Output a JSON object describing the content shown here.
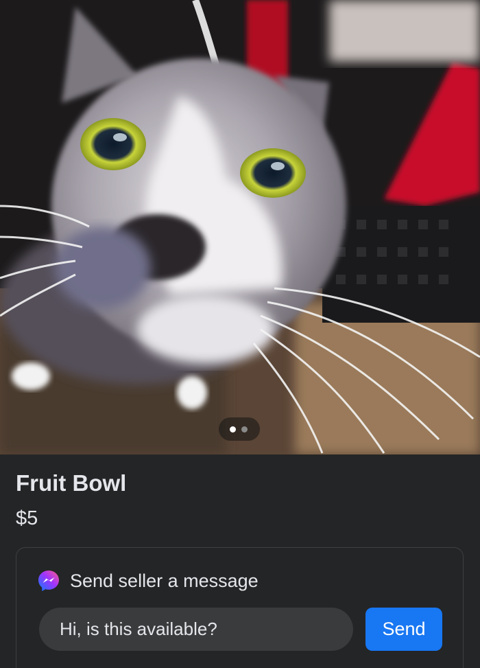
{
  "listing": {
    "title": "Fruit Bowl",
    "price": "$5",
    "photo": {
      "description_icon": "cat-photo",
      "carousel_count": 2,
      "carousel_active_index": 0
    }
  },
  "message": {
    "header_label": "Send seller a message",
    "header_icon": "messenger-icon",
    "input_value": "Hi, is this available?",
    "send_label": "Send"
  },
  "colors": {
    "background": "#242526",
    "card_border": "#3e4042",
    "input_background": "#3a3b3c",
    "accent": "#1877f2",
    "text": "#e4e6eb"
  }
}
